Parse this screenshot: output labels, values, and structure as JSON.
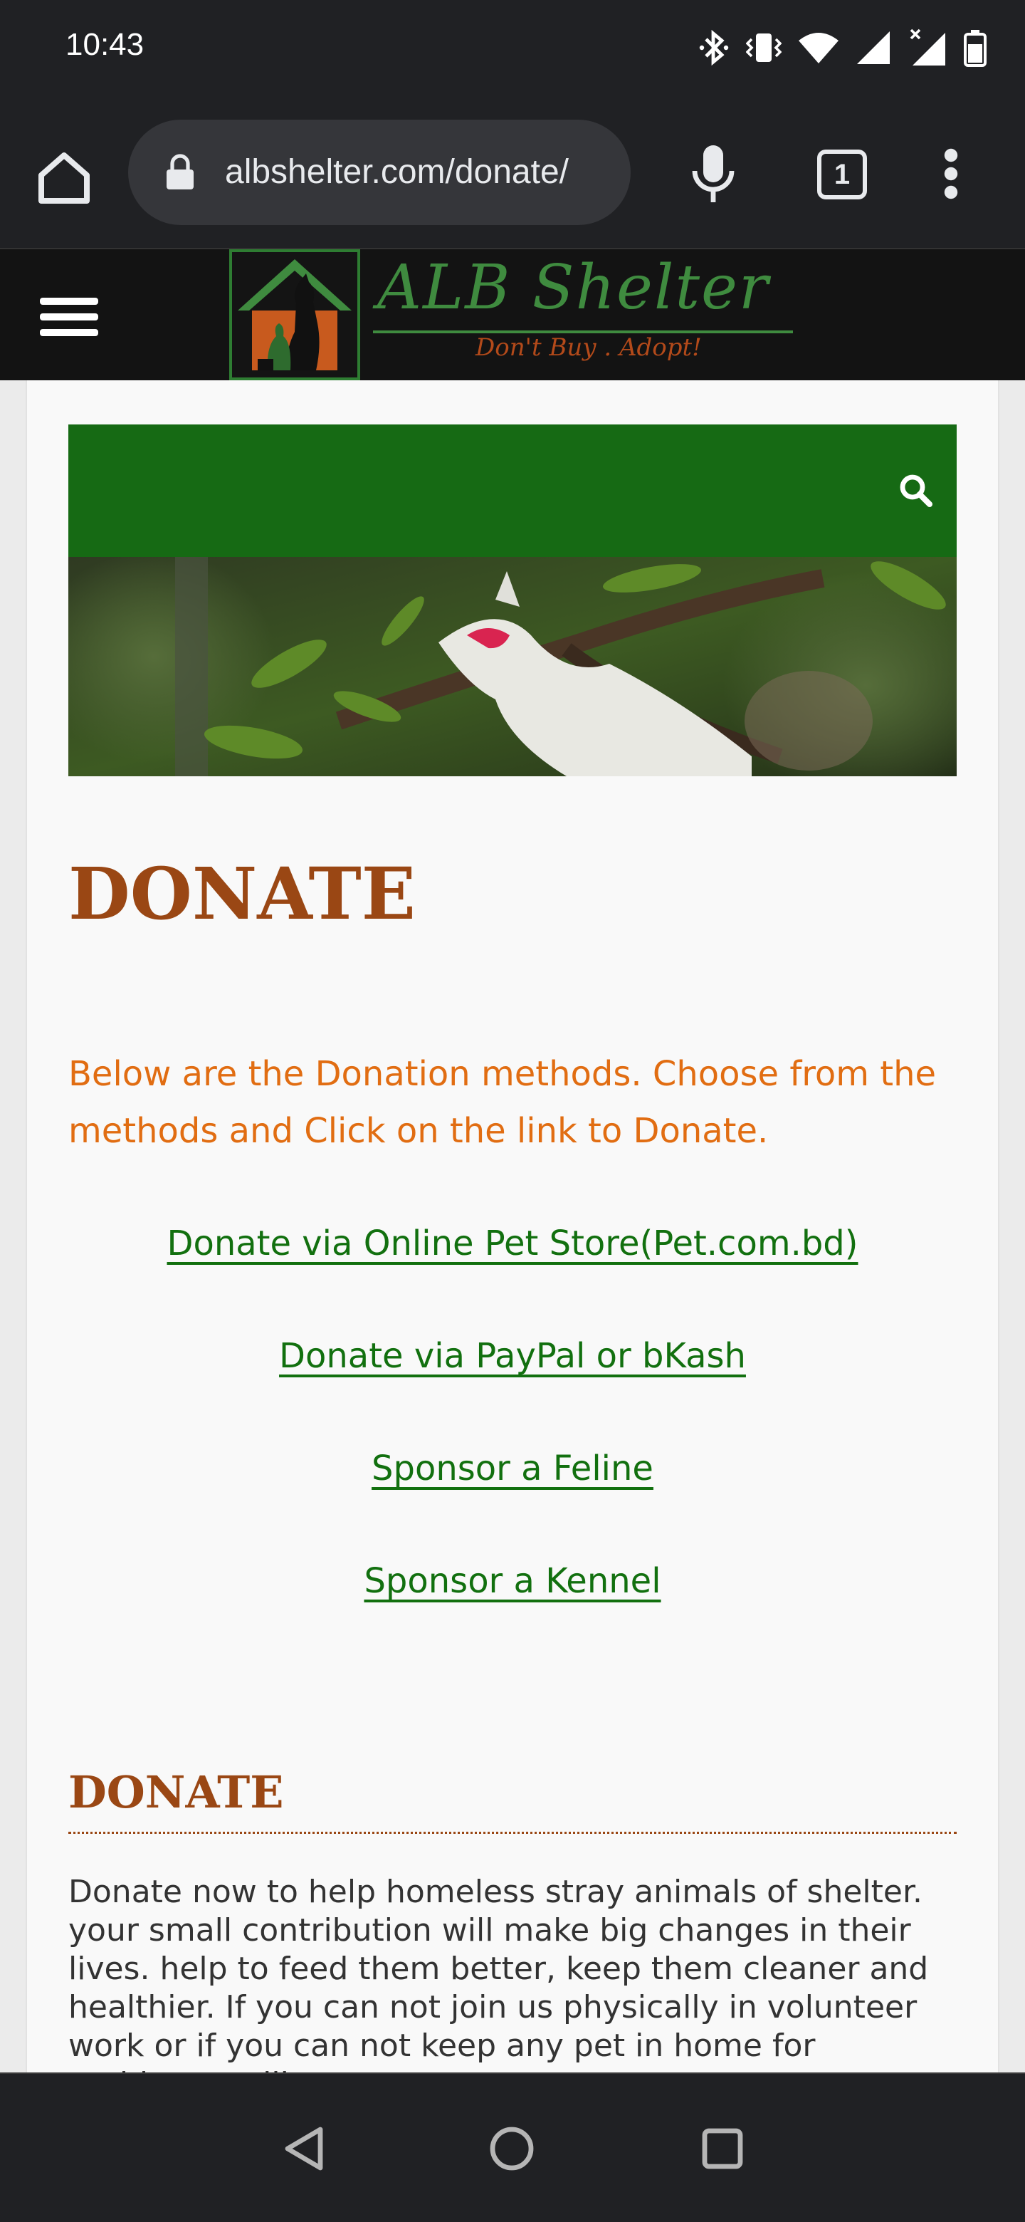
{
  "status_bar": {
    "time": "10:43",
    "icons": [
      "bluetooth-icon",
      "vibrate-icon",
      "wifi-icon",
      "signal-icon",
      "signal-x-icon",
      "battery-icon"
    ]
  },
  "browser": {
    "url": "albshelter.com/donate/",
    "tab_count": "1"
  },
  "site": {
    "logo_title": "ALB Shelter",
    "logo_tagline": "Don't Buy . Adopt!",
    "brand_green": "#166a14",
    "brand_brown": "#9a4714"
  },
  "main": {
    "title": "DONATE",
    "intro": "Below are the Donation methods. Choose from the methods and Click on the link to Donate.",
    "links": [
      "Donate via Online Pet Store(Pet.com.bd)",
      "Donate via PayPal or bKash",
      "Sponsor a Feline",
      "Sponsor a Kennel"
    ],
    "section_heading": "DONATE",
    "section_body": "Donate now to help homeless stray animals of shelter. your small contribution will make big changes in their lives. help to feed them better, keep them cleaner and healthier. If you can not join us physically in volunteer work or if you can not keep any pet in home for problems, still you can"
  }
}
